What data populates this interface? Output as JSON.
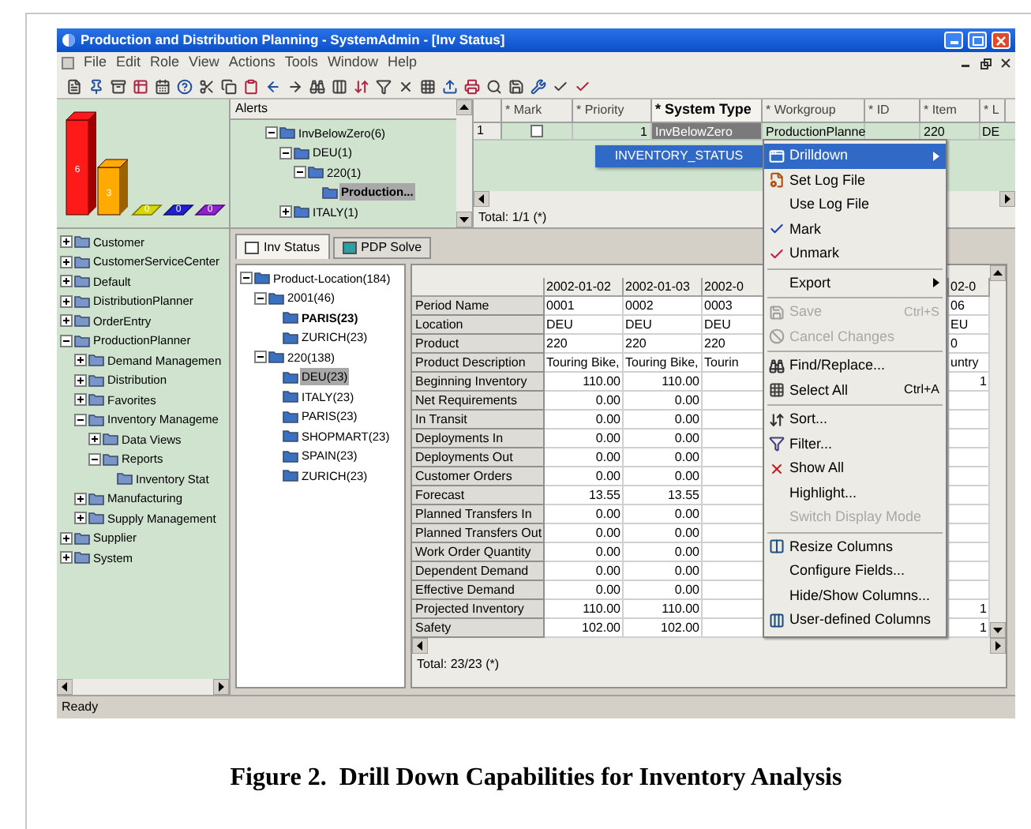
{
  "window": {
    "title": "Production and Distribution Planning - SystemAdmin - [Inv Status]"
  },
  "menu_bar": [
    "File",
    "Edit",
    "Role",
    "View",
    "Actions",
    "Tools",
    "Window",
    "Help"
  ],
  "alert_chart": {
    "bar_labels": [
      "6",
      "3",
      "0",
      "0",
      "0"
    ]
  },
  "left_tree": [
    {
      "label": "Customer",
      "kind": "branch",
      "expanded": false,
      "selected": false
    },
    {
      "label": "CustomerServiceCenter",
      "kind": "branch",
      "expanded": false,
      "selected": false
    },
    {
      "label": "Default",
      "kind": "branch",
      "expanded": false,
      "selected": false
    },
    {
      "label": "DistributionPlanner",
      "kind": "branch",
      "expanded": false,
      "selected": false
    },
    {
      "label": "OrderEntry",
      "kind": "branch",
      "expanded": false,
      "selected": false
    },
    {
      "label": "ProductionPlanner",
      "kind": "branch",
      "expanded": true,
      "selected": false,
      "children": [
        {
          "label": "Demand Managemen",
          "kind": "branch",
          "expanded": false,
          "selected": false
        },
        {
          "label": "Distribution",
          "kind": "branch",
          "expanded": false,
          "selected": false
        },
        {
          "label": "Favorites",
          "kind": "branch",
          "expanded": false,
          "selected": false
        },
        {
          "label": "Inventory Manageme",
          "kind": "branch",
          "expanded": true,
          "selected": false,
          "children": [
            {
              "label": "Data Views",
              "kind": "branch",
              "expanded": false,
              "selected": false
            },
            {
              "label": "Reports",
              "kind": "branch",
              "expanded": true,
              "selected": false,
              "children": [
                {
                  "label": "Inventory Stat",
                  "kind": "leaf",
                  "selected": false
                }
              ]
            }
          ]
        },
        {
          "label": "Manufacturing",
          "kind": "branch",
          "expanded": false,
          "selected": false
        },
        {
          "label": "Supply Management",
          "kind": "branch",
          "expanded": false,
          "selected": false
        }
      ]
    },
    {
      "label": "Supplier",
      "kind": "branch",
      "expanded": false,
      "selected": false
    },
    {
      "label": "System",
      "kind": "branch",
      "expanded": false,
      "selected": false
    }
  ],
  "alerts": {
    "title": "Alerts",
    "tree": [
      {
        "label": "InvBelowZero(6)",
        "kind": "branch",
        "expanded": true,
        "selected": false,
        "bold": false,
        "children": [
          {
            "label": "DEU(1)",
            "kind": "branch",
            "expanded": true,
            "selected": false,
            "bold": false,
            "children": [
              {
                "label": "220(1)",
                "kind": "branch",
                "expanded": true,
                "selected": false,
                "bold": false,
                "children": [
                  {
                    "label": "Production...",
                    "kind": "leaf",
                    "selected": true,
                    "bold": true
                  }
                ]
              }
            ]
          },
          {
            "label": "ITALY(1)",
            "kind": "branch",
            "expanded": false,
            "selected": false,
            "bold": false
          }
        ]
      }
    ]
  },
  "alerts_table": {
    "columns": [
      {
        "label": "* Mark",
        "selected": false
      },
      {
        "label": "* Priority",
        "selected": false
      },
      {
        "label": "* System Type",
        "selected": true
      },
      {
        "label": "* Workgroup",
        "selected": false
      },
      {
        "label": "* ID",
        "selected": false
      },
      {
        "label": "* Item",
        "selected": false
      },
      {
        "label": "* L",
        "selected": false
      }
    ],
    "rows": [
      {
        "row_number": "1",
        "checked": false,
        "priority": "1",
        "system_type": "InvBelowZero",
        "selected": true,
        "workgroup": "ProductionPlanne",
        "item": "220",
        "column_7": "DE"
      }
    ],
    "footer": "Total: 1/1 (*)"
  },
  "drilldown_popup": {
    "label": "INVENTORY_STATUS"
  },
  "context_menu": [
    {
      "kind": "item",
      "label": "Drilldown",
      "selected": true,
      "disabled": false,
      "submenu": true
    },
    {
      "kind": "item",
      "label": "Set Log File",
      "selected": false,
      "disabled": false,
      "submenu": false
    },
    {
      "kind": "item",
      "label": "Use Log File",
      "selected": false,
      "disabled": false,
      "submenu": false
    },
    {
      "kind": "item",
      "label": "Mark",
      "selected": false,
      "disabled": false,
      "submenu": false
    },
    {
      "kind": "item",
      "label": "Unmark",
      "selected": false,
      "disabled": false,
      "submenu": false
    },
    {
      "kind": "separator"
    },
    {
      "kind": "item",
      "label": "Export",
      "selected": false,
      "disabled": false,
      "submenu": true
    },
    {
      "kind": "separator"
    },
    {
      "kind": "item",
      "label": "Save",
      "shortcut": "Ctrl+S",
      "selected": false,
      "disabled": true,
      "submenu": false
    },
    {
      "kind": "item",
      "label": "Cancel Changes",
      "selected": false,
      "disabled": true,
      "submenu": false
    },
    {
      "kind": "separator"
    },
    {
      "kind": "item",
      "label": "Find/Replace...",
      "selected": false,
      "disabled": false,
      "submenu": false
    },
    {
      "kind": "item",
      "label": "Select All",
      "shortcut": "Ctrl+A",
      "selected": false,
      "disabled": false,
      "submenu": false
    },
    {
      "kind": "separator"
    },
    {
      "kind": "item",
      "label": "Sort...",
      "selected": false,
      "disabled": false,
      "submenu": false
    },
    {
      "kind": "item",
      "label": "Filter...",
      "selected": false,
      "disabled": false,
      "submenu": false
    },
    {
      "kind": "item",
      "label": "Show All",
      "selected": false,
      "disabled": false,
      "submenu": false
    },
    {
      "kind": "item",
      "label": "Highlight...",
      "selected": false,
      "disabled": false,
      "submenu": false
    },
    {
      "kind": "item",
      "label": "Switch Display Mode",
      "selected": false,
      "disabled": true,
      "submenu": false
    },
    {
      "kind": "separator"
    },
    {
      "kind": "item",
      "label": "Resize Columns",
      "selected": false,
      "disabled": false,
      "submenu": false
    },
    {
      "kind": "item",
      "label": "Configure Fields...",
      "selected": false,
      "disabled": false,
      "submenu": false
    },
    {
      "kind": "item",
      "label": "Hide/Show Columns...",
      "selected": false,
      "disabled": false,
      "submenu": false
    },
    {
      "kind": "item",
      "label": "User-defined Columns",
      "selected": false,
      "disabled": false,
      "submenu": false
    }
  ],
  "tabs": [
    {
      "label": "Inv Status",
      "selected": true
    },
    {
      "label": "PDP Solve",
      "selected": false
    }
  ],
  "product_tree": [
    {
      "label": "Product-Location(184)",
      "kind": "branch",
      "expanded": true,
      "selected": false,
      "bold": false,
      "children": [
        {
          "label": "2001(46)",
          "kind": "branch",
          "expanded": true,
          "selected": false,
          "bold": false,
          "children": [
            {
              "label": "PARIS(23)",
              "kind": "leaf",
              "selected": false,
              "bold": true
            },
            {
              "label": "ZURICH(23)",
              "kind": "leaf",
              "selected": false,
              "bold": false
            }
          ]
        },
        {
          "label": "220(138)",
          "kind": "branch",
          "expanded": true,
          "selected": false,
          "bold": false,
          "children": [
            {
              "label": "DEU(23)",
              "kind": "leaf",
              "selected": true,
              "bold": false
            },
            {
              "label": "ITALY(23)",
              "kind": "leaf",
              "selected": false,
              "bold": false
            },
            {
              "label": "PARIS(23)",
              "kind": "leaf",
              "selected": false,
              "bold": false
            },
            {
              "label": "SHOPMART(23)",
              "kind": "leaf",
              "selected": false,
              "bold": false
            },
            {
              "label": "SPAIN(23)",
              "kind": "leaf",
              "selected": false,
              "bold": false
            },
            {
              "label": "ZURICH(23)",
              "kind": "leaf",
              "selected": false,
              "bold": false
            }
          ]
        }
      ]
    }
  ],
  "grid": {
    "columns": [
      "2002-01-02",
      "2002-01-03",
      "2002-0",
      "02-0"
    ],
    "rows": [
      {
        "label": "Period Name",
        "kind": "text",
        "column_1": "0001",
        "column_2": "0002",
        "column_3": "0003",
        "column_4": "06"
      },
      {
        "label": "Location",
        "kind": "text",
        "column_1": "DEU",
        "column_2": "DEU",
        "column_3": "DEU",
        "column_4": "EU"
      },
      {
        "label": "Product",
        "kind": "text",
        "column_1": "220",
        "column_2": "220",
        "column_3": "220",
        "column_4": "0"
      },
      {
        "label": "Product Description",
        "kind": "text",
        "column_1": "Touring Bike,",
        "column_2": "Touring Bike,",
        "column_3": "Tourin",
        "column_4": "untry"
      },
      {
        "label": "Beginning Inventory",
        "kind": "number",
        "column_1": "110.00",
        "column_2": "110.00",
        "column_4": "1"
      },
      {
        "label": "Net Requirements",
        "kind": "number",
        "column_1": "0.00",
        "column_2": "0.00"
      },
      {
        "label": "In Transit",
        "kind": "number",
        "column_1": "0.00",
        "column_2": "0.00"
      },
      {
        "label": "Deployments In",
        "kind": "number",
        "column_1": "0.00",
        "column_2": "0.00"
      },
      {
        "label": "Deployments Out",
        "kind": "number",
        "column_1": "0.00",
        "column_2": "0.00"
      },
      {
        "label": "Customer Orders",
        "kind": "number",
        "column_1": "0.00",
        "column_2": "0.00"
      },
      {
        "label": "Forecast",
        "kind": "number",
        "column_1": "13.55",
        "column_2": "13.55"
      },
      {
        "label": "Planned Transfers In",
        "kind": "number",
        "column_1": "0.00",
        "column_2": "0.00"
      },
      {
        "label": "Planned Transfers Out",
        "kind": "number",
        "column_1": "0.00",
        "column_2": "0.00"
      },
      {
        "label": "Work Order Quantity",
        "kind": "number",
        "column_1": "0.00",
        "column_2": "0.00"
      },
      {
        "label": "Dependent Demand",
        "kind": "number",
        "column_1": "0.00",
        "column_2": "0.00"
      },
      {
        "label": "Effective Demand",
        "kind": "number",
        "column_1": "0.00",
        "column_2": "0.00"
      },
      {
        "label": "Projected Inventory",
        "kind": "number",
        "column_1": "110.00",
        "column_2": "110.00",
        "column_4": "1"
      },
      {
        "label": "Safety",
        "kind": "number",
        "column_1": "102.00",
        "column_2": "102.00",
        "column_4": "1"
      }
    ],
    "footer": "Total: 23/23 (*)"
  },
  "status_bar": "Ready",
  "caption": "Figure 2.  Drill Down Capabilities for Inventory Analysis"
}
